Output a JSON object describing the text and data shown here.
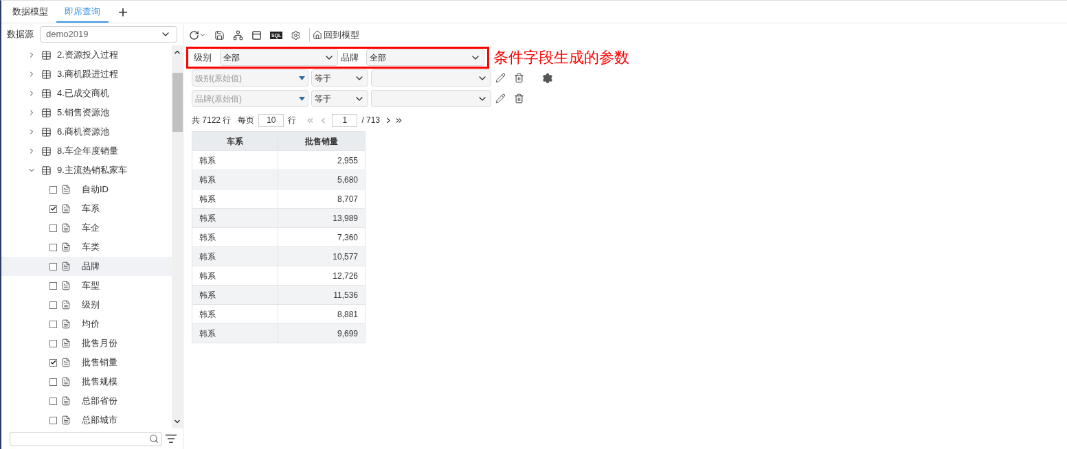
{
  "tabs": [
    {
      "label": "数据模型",
      "selected": false
    },
    {
      "label": "即席查询",
      "selected": true
    }
  ],
  "sidebar": {
    "datasource_label": "数据源",
    "datasource_value": "demo2019",
    "tree": [
      {
        "label": "2.资源投入过程",
        "expanded": false,
        "selected": false
      },
      {
        "label": "3.商机跟进过程",
        "expanded": false,
        "selected": false
      },
      {
        "label": "4.已成交商机",
        "expanded": false,
        "selected": false
      },
      {
        "label": "5.销售资源池",
        "expanded": false,
        "selected": false
      },
      {
        "label": "6.商机资源池",
        "expanded": false,
        "selected": false
      },
      {
        "label": "8.车企年度销量",
        "expanded": false,
        "selected": false
      },
      {
        "label": "9.主流热销私家车",
        "expanded": true,
        "selected": false,
        "children": [
          {
            "label": "自动ID",
            "checked": false,
            "selected": false
          },
          {
            "label": "车系",
            "checked": true,
            "selected": false
          },
          {
            "label": "车企",
            "checked": false,
            "selected": false
          },
          {
            "label": "车类",
            "checked": false,
            "selected": false
          },
          {
            "label": "品牌",
            "checked": false,
            "selected": true
          },
          {
            "label": "车型",
            "checked": false,
            "selected": false
          },
          {
            "label": "级别",
            "checked": false,
            "selected": false
          },
          {
            "label": "均价",
            "checked": false,
            "selected": false
          },
          {
            "label": "批售月份",
            "checked": false,
            "selected": false
          },
          {
            "label": "批售销量",
            "checked": true,
            "selected": false
          },
          {
            "label": "批售规模",
            "checked": false,
            "selected": false
          },
          {
            "label": "总部省份",
            "checked": false,
            "selected": false
          },
          {
            "label": "总部城市",
            "checked": false,
            "selected": false
          }
        ]
      }
    ]
  },
  "toolbar": {
    "sql_label": "SQL",
    "back_label": "回到模型"
  },
  "parameters": [
    {
      "label": "级别",
      "value": "全部"
    },
    {
      "label": "品牌",
      "value": "全部"
    }
  ],
  "annotation": "条件字段生成的参数",
  "filters": [
    {
      "field": "级别(原始值)",
      "operator": "等于"
    },
    {
      "field": "品牌(原始值)",
      "operator": "等于"
    }
  ],
  "pagination": {
    "total": "共 7122 行",
    "per_page_label": "每页",
    "per_page": "10",
    "rows_label": "行",
    "page": "1",
    "pages": "/ 713"
  },
  "table": {
    "columns": [
      "车系",
      "批售销量"
    ],
    "rows": [
      [
        "韩系",
        "2,955"
      ],
      [
        "韩系",
        "5,680"
      ],
      [
        "韩系",
        "8,707"
      ],
      [
        "韩系",
        "13,989"
      ],
      [
        "韩系",
        "7,360"
      ],
      [
        "韩系",
        "10,577"
      ],
      [
        "韩系",
        "12,726"
      ],
      [
        "韩系",
        "11,536"
      ],
      [
        "韩系",
        "8,881"
      ],
      [
        "韩系",
        "9,699"
      ]
    ]
  }
}
